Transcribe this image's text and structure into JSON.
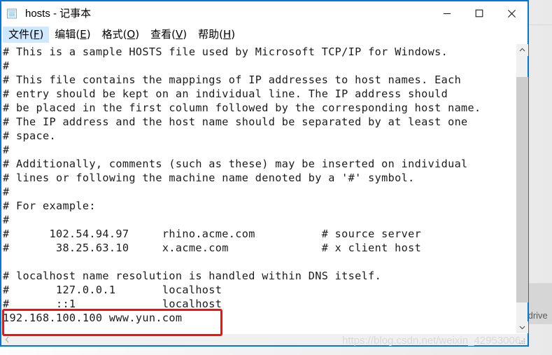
{
  "window": {
    "title": "hosts - 记事本",
    "icon": "notepad-icon",
    "accent_color": "#0078d7",
    "controls": {
      "minimize": "−",
      "maximize": "□",
      "close": "✕"
    }
  },
  "menu": {
    "items": [
      {
        "label_before": "文件(",
        "accel": "F",
        "label_after": ")",
        "active": true
      },
      {
        "label_before": "编辑(",
        "accel": "E",
        "label_after": ")",
        "active": false
      },
      {
        "label_before": "格式(",
        "accel": "O",
        "label_after": ")",
        "active": false
      },
      {
        "label_before": "查看(",
        "accel": "V",
        "label_after": ")",
        "active": false
      },
      {
        "label_before": "帮助(",
        "accel": "H",
        "label_after": ")",
        "active": false
      }
    ]
  },
  "editor": {
    "lines": [
      "# This is a sample HOSTS file used by Microsoft TCP/IP for Windows.",
      "#",
      "# This file contains the mappings of IP addresses to host names. Each",
      "# entry should be kept on an individual line. The IP address should",
      "# be placed in the first column followed by the corresponding host name.",
      "# The IP address and the host name should be separated by at least one",
      "# space.",
      "#",
      "# Additionally, comments (such as these) may be inserted on individual",
      "# lines or following the machine name denoted by a '#' symbol.",
      "#",
      "# For example:",
      "#",
      "#      102.54.94.97     rhino.acme.com          # source server",
      "#       38.25.63.10     x.acme.com              # x client host",
      "",
      "# localhost name resolution is handled within DNS itself.",
      "#       127.0.0.1       localhost",
      "#       ::1             localhost",
      "192.168.100.100 www.yun.com"
    ]
  },
  "scrollbars": {
    "vertical": {
      "up_arrow": "⌃",
      "down_arrow": "⌄"
    },
    "horizontal": {
      "left_arrow": "❮"
    }
  },
  "annotation": {
    "highlight_color": "#fb0d0d",
    "highlighted_line": "192.168.100.100 www.yun.com"
  },
  "watermark": {
    "text": "https://blog.csdn.net/weixin_42953006"
  },
  "background": {
    "path_text": "\\drive"
  }
}
